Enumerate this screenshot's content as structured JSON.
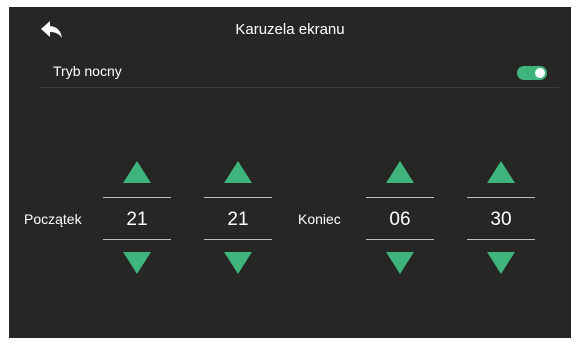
{
  "header": {
    "back_icon": "back-arrow-icon",
    "title": "Karuzela ekranu"
  },
  "night_mode": {
    "label": "Tryb nocny",
    "enabled": true
  },
  "start": {
    "label": "Początek",
    "hour": "21",
    "minute": "21"
  },
  "end": {
    "label": "Koniec",
    "hour": "06",
    "minute": "30"
  },
  "colors": {
    "background": "#262624",
    "accent": "#3fb47c",
    "text": "#ffffff",
    "divider": "#3c3c3a",
    "value_lines": "#bdbdbd"
  },
  "icons": {
    "increment": "triangle-up-icon",
    "decrement": "triangle-down-icon"
  }
}
